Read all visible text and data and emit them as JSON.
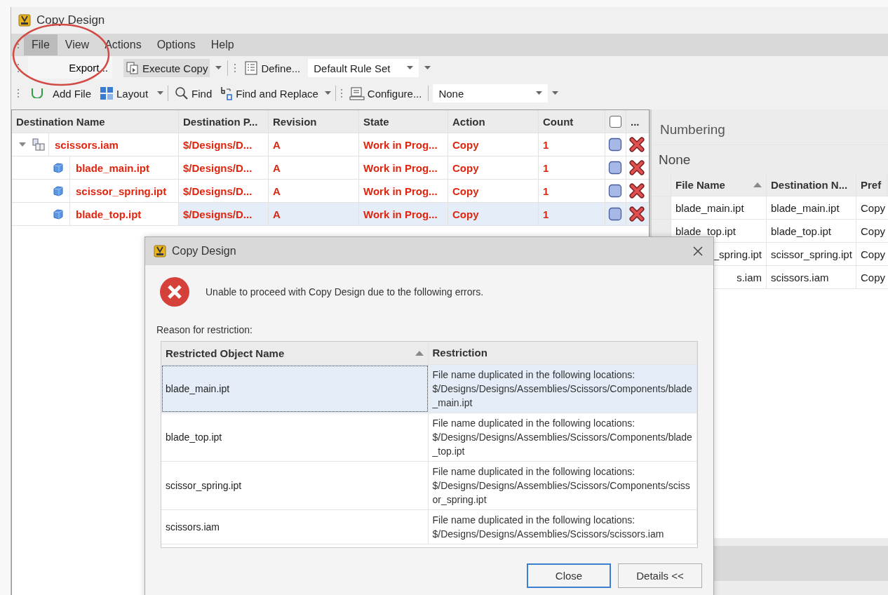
{
  "window": {
    "title": "Copy Design"
  },
  "menu_bar": [
    {
      "label": "File",
      "selected": true
    },
    {
      "label": "View",
      "selected": false
    },
    {
      "label": "Actions",
      "selected": false
    },
    {
      "label": "Options",
      "selected": false
    },
    {
      "label": "Help",
      "selected": false
    }
  ],
  "file_menu": [
    "Export..."
  ],
  "toolbar_1": {
    "execute_copy": "Execute Copy",
    "define": "Define...",
    "rule_set": "Default Rule Set"
  },
  "toolbar_2": {
    "add_files": "Add File",
    "layout": "Layout",
    "find": "Find",
    "find_replace": "Find and Replace",
    "configure": "Configure...",
    "filter": "None"
  },
  "grid": {
    "columns": [
      "Destination Name",
      "Destination P...",
      "Revision",
      "State",
      "Action",
      "Count"
    ],
    "check_column_checked": false,
    "more_column": "...",
    "rows": [
      {
        "name": "scissors.iam",
        "kind": "assembly",
        "expanded": true,
        "path": "$/Designs/D...",
        "revision": "A",
        "state": "Work in Prog...",
        "action": "Copy",
        "count": "1",
        "selected": false,
        "children": [
          {
            "name": "blade_main.ipt",
            "kind": "part",
            "path": "$/Designs/D...",
            "revision": "A",
            "state": "Work in Prog...",
            "action": "Copy",
            "count": "1",
            "selected": false
          },
          {
            "name": "scissor_spring.ipt",
            "kind": "part",
            "path": "$/Designs/D...",
            "revision": "A",
            "state": "Work in Prog...",
            "action": "Copy",
            "count": "1",
            "selected": false
          },
          {
            "name": "blade_top.ipt",
            "kind": "part",
            "path": "$/Designs/D...",
            "revision": "A",
            "state": "Work in Prog...",
            "action": "Copy",
            "count": "1",
            "selected": true
          }
        ]
      }
    ]
  },
  "numbering": {
    "title": "Numbering",
    "scheme": "None",
    "columns": [
      {
        "label": "File Name",
        "sorted": true
      },
      {
        "label": "Destination N...",
        "sorted": false
      },
      {
        "label": "Pref"
      }
    ],
    "rows": [
      {
        "file_name": "blade_main.ipt",
        "covered": false,
        "destination": "blade_main.ipt",
        "column_3": "Copy"
      },
      {
        "file_name": "blade_top.ipt",
        "covered": false,
        "destination": "blade_top.ipt",
        "column_3": "Copy"
      },
      {
        "file_name": "_spring.ipt",
        "covered": true,
        "destination": "scissor_spring.ipt",
        "column_3": "Copy"
      },
      {
        "file_name": "s.iam",
        "covered": true,
        "destination": "scissors.iam",
        "column_3": "Copy"
      }
    ]
  },
  "dialog": {
    "title": "Copy Design",
    "message": "Unable to proceed with Copy Design due to the following errors.",
    "reason_label": "Reason for restriction:",
    "columns": [
      {
        "label": "Restricted Object Name",
        "sorted": true
      },
      {
        "label": "Restriction",
        "sorted": false
      }
    ],
    "rows": [
      {
        "object": "blade_main.ipt",
        "restriction": "File name duplicated in the following locations:\n$/Designs/Designs/Assemblies/Scissors/Components/blade_main.ipt",
        "selected": true
      },
      {
        "object": "blade_top.ipt",
        "restriction": "File name duplicated in the following locations:\n$/Designs/Designs/Assemblies/Scissors/Components/blade_top.ipt",
        "selected": false
      },
      {
        "object": "scissor_spring.ipt",
        "restriction": "File name duplicated in the following locations:\n$/Designs/Designs/Assemblies/Scissors/Components/scissor_spring.ipt",
        "selected": false
      },
      {
        "object": "scissors.iam",
        "restriction": "File name duplicated in the following locations:\n$/Designs/Designs/Assemblies/Scissors/scissors.iam",
        "selected": false
      }
    ],
    "buttons": [
      {
        "label": "Close",
        "default": true
      },
      {
        "label": "Details <<",
        "default": false
      }
    ]
  }
}
